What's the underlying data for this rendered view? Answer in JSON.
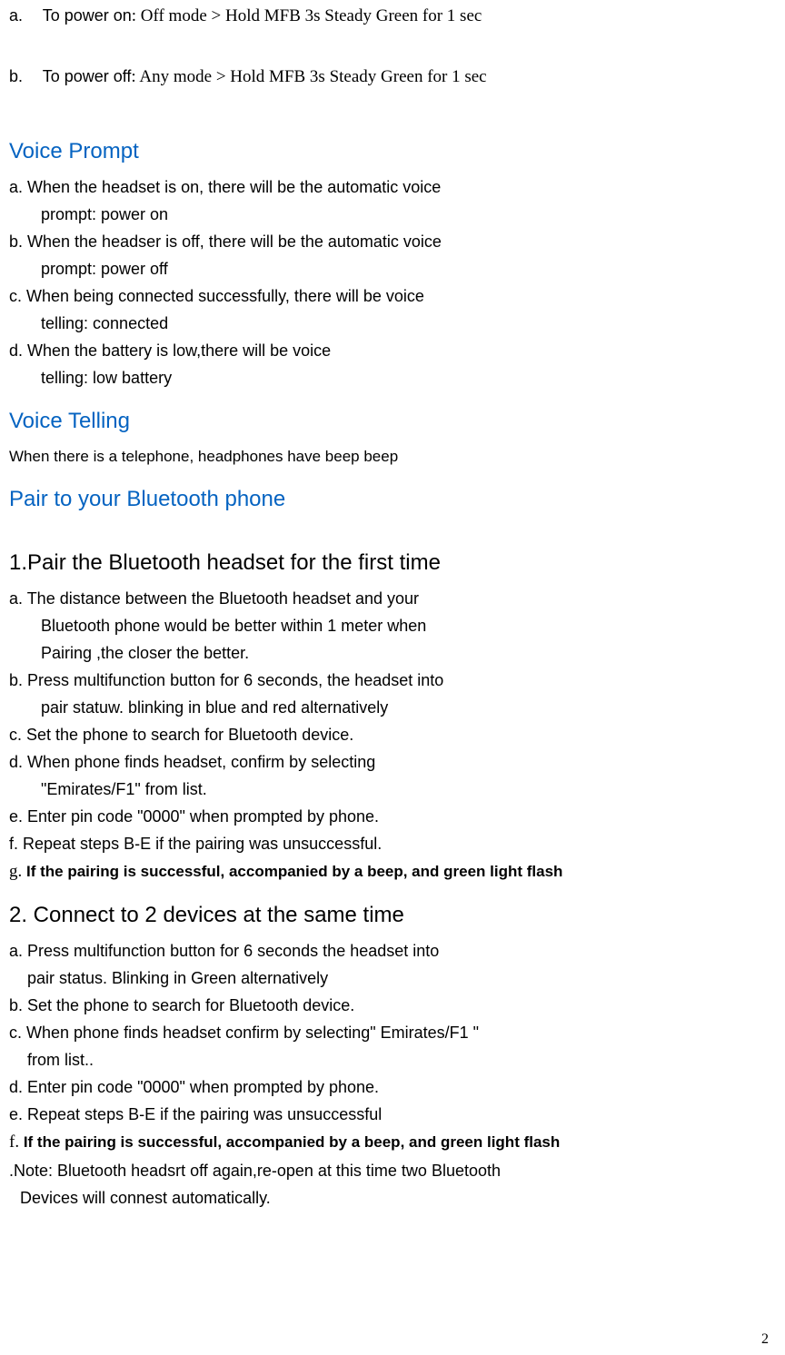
{
  "power": {
    "a_prefix": "a.",
    "a_label": "To power on",
    "a_text": ": Off mode > Hold MFB 3s Steady Green for 1 sec",
    "b_prefix": "b.",
    "b_label": "To power off",
    "b_text": ": Any mode > Hold MFB 3s Steady Green for 1 sec"
  },
  "voice_prompt": {
    "heading": "Voice Prompt",
    "items": {
      "a1": "a.    When the headset is on, there will be the automatic voice",
      "a2": "prompt: power on",
      "b1": "b.    When the headser is off, there will be the automatic voice",
      "b2": "prompt: power off",
      "c1": "c.    When being connected successfully, there will be voice",
      "c2": "telling: connected",
      "d1": "d.    When the battery is low,there will be voice",
      "d2": "telling: low battery"
    }
  },
  "voice_telling": {
    "heading": "Voice Telling",
    "body": "When there is a telephone, headphones have beep beep"
  },
  "pair_heading": "Pair to your Bluetooth phone",
  "pair1": {
    "heading": "1.Pair the Bluetooth headset for the first time",
    "a1": "a. The distance between the Bluetooth headset and your",
    "a2": "Bluetooth phone would be better within 1 meter when",
    "a3": "Pairing ,the closer the better.",
    "b1": "b. Press multifunction button for 6 seconds, the headset into",
    "b2": "pair statuw. blinking in blue and red alternatively",
    "c": "c. Set the phone to search for Bluetooth device.",
    "d1": "d. When phone finds headset, confirm by selecting",
    "d2": "\"Emirates/F1\" from list.",
    "e": "e. Enter pin code \"0000\" when prompted by phone.",
    "f": "f. Repeat steps B-E if the pairing was unsuccessful.",
    "g_prefix": "g. ",
    "g_bold": "If the pairing is successful, accompanied by a beep, and green light flash"
  },
  "pair2": {
    "heading": "2. Connect to 2 devices at the same time",
    "a1": "a. Press multifunction button for 6 seconds the headset into",
    "a2": "pair status. Blinking in Green alternatively",
    "b": "b. Set the phone to search for Bluetooth device.",
    "c1": "c. When phone finds headset confirm by selecting\" Emirates/F1 \"",
    "c2": "from list..",
    "d": "d. Enter pin code \"0000\" when prompted by phone.",
    "e": "e. Repeat steps B-E if the pairing was unsuccessful",
    "f_prefix": "f. ",
    "f_bold": "If the pairing is successful, accompanied by a beep, and green light flash",
    "note1": ".Note: Bluetooth headsrt off again,re-open at this time two Bluetooth",
    "note2": "Devices will connest automatically."
  },
  "page_number": "2"
}
